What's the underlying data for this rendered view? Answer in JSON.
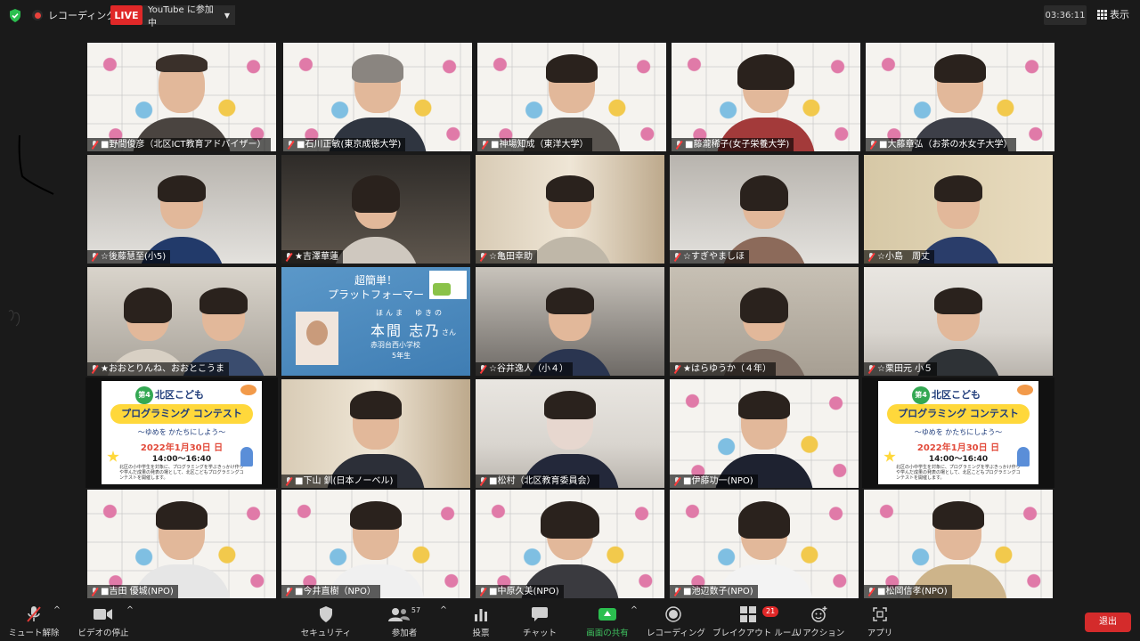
{
  "topbar": {
    "recording": "レコーディング中",
    "live": "LIVE",
    "youtube": "YouTube に参加中",
    "timer": "03:36:11",
    "view": "表示"
  },
  "gallery": {
    "tiles": [
      {
        "name": "■野間俊彦（北区ICT教育アドバイザー）"
      },
      {
        "name": "■石川正敏(東京成徳大学)"
      },
      {
        "name": "■神場知成（東洋大学）"
      },
      {
        "name": "■藤瀧稀子(女子栄養大学)"
      },
      {
        "name": "■大藤章弘（お茶の水女子大学）"
      },
      {
        "name": "☆後藤慧至(小5)"
      },
      {
        "name": "★吉澤華蓮"
      },
      {
        "name": "☆亀田幸助"
      },
      {
        "name": "☆すぎやましほ"
      },
      {
        "name": "☆小島　周丈"
      },
      {
        "name": "★おおとりんね、おおとこうま"
      },
      {
        "name": ""
      },
      {
        "name": "☆谷井逸人（小４）"
      },
      {
        "name": "★はらゆうか（４年）"
      },
      {
        "name": "☆栗田元 小５"
      },
      {
        "name": ""
      },
      {
        "name": "■下山 釧(日本ノーベル)"
      },
      {
        "name": "■松村（北区教育委員会）"
      },
      {
        "name": "■伊藤功一(NPO)"
      },
      {
        "name": ""
      },
      {
        "name": "■吉田 優城(NPO)"
      },
      {
        "name": "■今井直樹（NPO）"
      },
      {
        "name": "■中原久美(NPO)"
      },
      {
        "name": "■池辺数子(NPO)"
      },
      {
        "name": "■松岡信孝(NPO)"
      }
    ],
    "slide": {
      "title1": "超簡単！",
      "title2": "プラットフォーマー",
      "kana": "ほんま　ゆきの",
      "name": "本間 志乃",
      "san": "さん",
      "school": "赤羽台西小学校",
      "grade": "5年生"
    },
    "flyer": {
      "round": "第4回",
      "title": "北区こども",
      "banner": "プログラミング コンテスト",
      "subtitle": "〜ゆめを かたちにしよう〜",
      "date": "2022年1月30日 日",
      "time": "14:00〜16:40",
      "note": "北区の小中学生を対象に、プログラミングを学ぶきっかけ作りや学んだ成果の発表の場として、北区こどもプログラミングコンテストを開催します。"
    }
  },
  "toolbar": {
    "mute": "ミュート解除",
    "video": "ビデオの停止",
    "security": "セキュリティ",
    "participants": "参加者",
    "participant_count": "57",
    "polls": "投票",
    "chat": "チャット",
    "share": "画面の共有",
    "record": "レコーディング",
    "breakout": "ブレイクアウト ルーム",
    "breakout_count": "21",
    "reactions": "リアクション",
    "apps": "アプリ",
    "leave": "退出"
  }
}
